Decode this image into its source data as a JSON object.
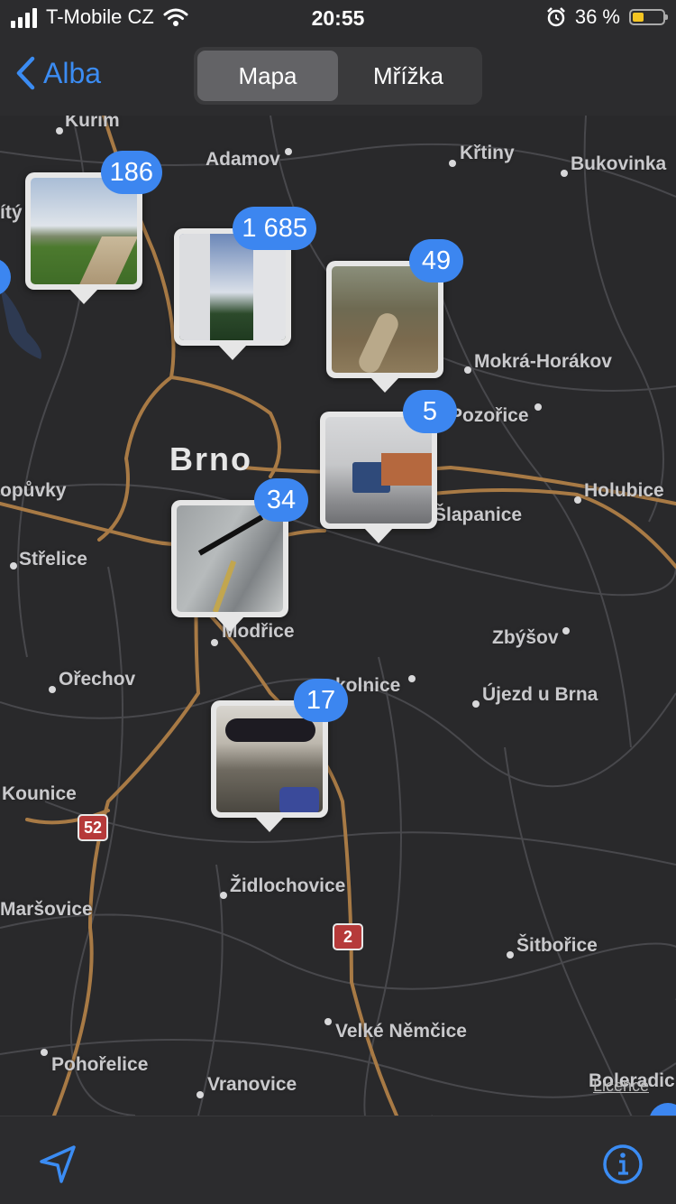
{
  "status": {
    "carrier": "T-Mobile CZ",
    "time": "20:55",
    "battery": "36 %",
    "battery_level": 0.36
  },
  "nav": {
    "back_label": "Alba",
    "segments": [
      {
        "label": "Mapa",
        "active": true
      },
      {
        "label": "Mřížka",
        "active": false
      }
    ]
  },
  "map": {
    "city": "Brno",
    "places": {
      "kurim": "Kuřim",
      "adamov": "Adamov",
      "krtiny": "Křtiny",
      "bukovinka": "Bukovinka",
      "vity": "ítý",
      "mokra": "Mokrá-Horákov",
      "pozorice": "Pozořice",
      "popuvky": "opůvky",
      "holubice": "Holubice",
      "slapanice": "Šlapanice",
      "strelice": "Střelice",
      "modrice": "Modřice",
      "zbysov": "Zbýšov",
      "orechov": "Ořechov",
      "sokolnice": "kolnice",
      "ujezd": "Újezd u Brna",
      "kounice": "Kounice",
      "zidlochovice": "Židlochovice",
      "marsovice": "Maršovice",
      "sitborice": "Šitbořice",
      "nemcice": "Velké Němčice",
      "pohorelice": "Pohořelice",
      "vranovice": "Vranovice",
      "boleradice": "Boleradic"
    },
    "shields": [
      "52",
      "2"
    ],
    "licence": "Licence"
  },
  "pins": [
    {
      "count": "186"
    },
    {
      "count": "1 685"
    },
    {
      "count": "49"
    },
    {
      "count": "5"
    },
    {
      "count": "34"
    },
    {
      "count": "17"
    }
  ],
  "colors": {
    "accent": "#3c86f0",
    "map_bg": "#29292b",
    "road": "#a87a45",
    "badge": "#3c86f0"
  }
}
